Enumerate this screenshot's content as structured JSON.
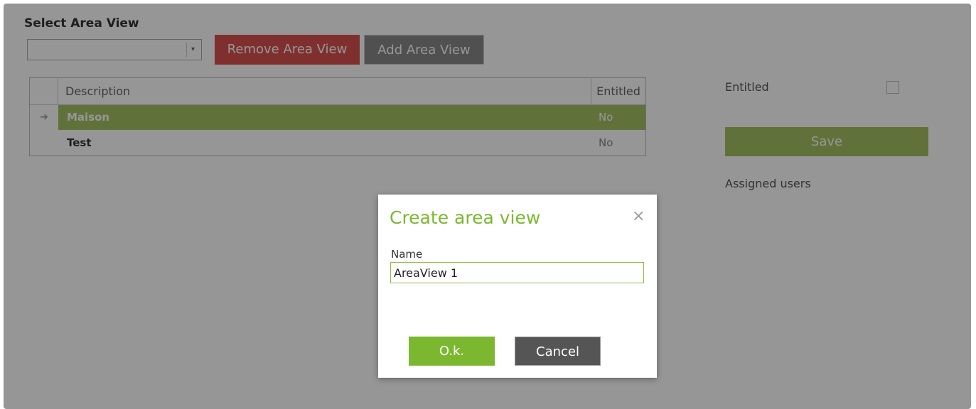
{
  "area_view": {
    "section_title": "Select Area View",
    "select_value": "",
    "remove_label": "Remove Area View",
    "add_label": "Add Area View"
  },
  "grid": {
    "columns": [
      "Description",
      "Entitled"
    ],
    "rows": [
      {
        "description": "Maison",
        "entitled": "No",
        "selected": true
      },
      {
        "description": "Test",
        "entitled": "No",
        "selected": false
      }
    ]
  },
  "details": {
    "entitled_label": "Entitled",
    "entitled_checked": false,
    "save_label": "Save",
    "assigned_users_label": "Assigned users"
  },
  "modal": {
    "title": "Create area view",
    "close_glyph": "×",
    "name_label": "Name",
    "name_value": "AreaView 1",
    "ok_label": "O.k.",
    "cancel_label": "Cancel"
  },
  "colors": {
    "accent_green": "#7cb82f",
    "selected_row": "#a4c264",
    "danger": "#d9534f"
  },
  "icons": {
    "row_selector": "arrow-circle-right-icon",
    "dropdown": "caret-down-icon",
    "close": "close-icon"
  }
}
